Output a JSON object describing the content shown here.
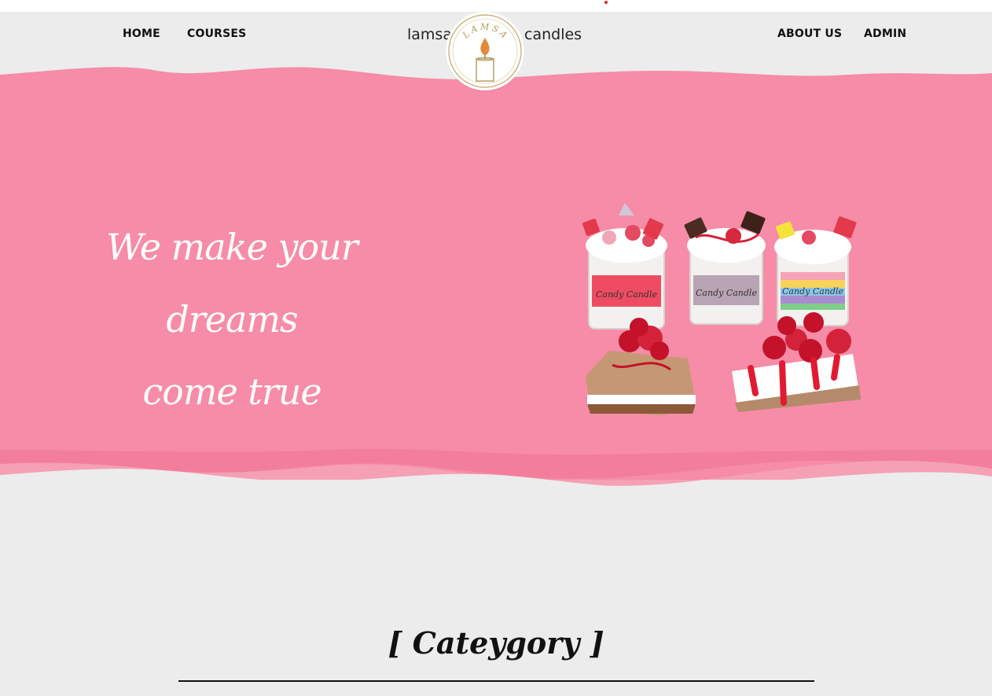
{
  "nav": {
    "left": [
      {
        "label": "HOME"
      },
      {
        "label": "COURSES"
      }
    ],
    "right": [
      {
        "label": "ABOUT US"
      },
      {
        "label": "ADMIN"
      }
    ]
  },
  "brand": {
    "left_word": "lamsa",
    "right_word": "candles",
    "logo_text": "LAMSA",
    "logo_icon": "candle-icon"
  },
  "hero": {
    "tagline_line1": "We make your dreams",
    "tagline_line2": "come true",
    "image_icon": "candle-desserts-image",
    "candle_labels": [
      "Candy Candle",
      "Candy Candle",
      "Candy Candle"
    ]
  },
  "category": {
    "title": "[ Cateygory ]"
  },
  "colors": {
    "background": "#ececec",
    "hero_pink": "#f68ca7",
    "hero_pink_dark": "#f07a98",
    "text_dark": "#111111",
    "accent_red": "#d8262c"
  }
}
